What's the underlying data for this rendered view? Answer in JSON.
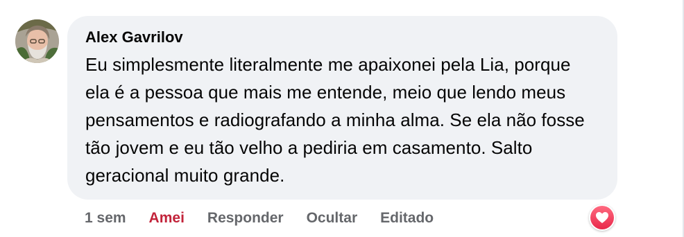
{
  "comment": {
    "author": "Alex Gavrilov",
    "text": "Eu simplesmente literalmente me apaixonei pela Lia, porque ela é a pessoa que mais me entende, meio que lendo meus pensamentos e radiografando a minha alma. Se ela não fosse tão jovem e eu tão velho a pediria em casamento. Salto geracional muito grande."
  },
  "actions": {
    "time": "1 sem",
    "reaction": "Amei",
    "reply": "Responder",
    "hide": "Ocultar",
    "edited": "Editado"
  },
  "reaction_badge": {
    "icon": "heart-icon",
    "color": "#f02849"
  },
  "colors": {
    "bubble": "#f0f2f5",
    "text": "#050505",
    "secondary": "#65676b",
    "love": "#c2233a"
  }
}
